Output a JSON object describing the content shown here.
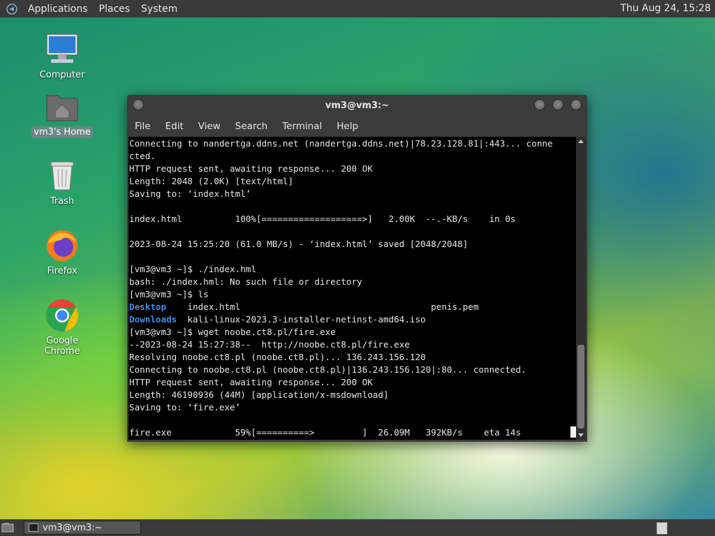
{
  "top_panel": {
    "menus": [
      "Applications",
      "Places",
      "System"
    ],
    "clock": "Thu Aug 24, 15:28"
  },
  "desktop_icons": [
    {
      "label": "Computer",
      "icon": "computer-icon"
    },
    {
      "label": "vm3's Home",
      "icon": "home-folder-icon",
      "selected": true
    },
    {
      "label": "Trash",
      "icon": "trash-icon"
    },
    {
      "label": "Firefox",
      "icon": "firefox-icon"
    },
    {
      "label": "Google Chrome",
      "icon": "chrome-icon"
    }
  ],
  "terminal": {
    "title": "vm3@vm3:~",
    "menu": [
      "File",
      "Edit",
      "View",
      "Search",
      "Terminal",
      "Help"
    ],
    "lines": [
      "Connecting to nandertga.ddns.net (nandertga.ddns.net)|78.23.128.81|:443... conne",
      "cted.",
      "HTTP request sent, awaiting response... 200 OK",
      "Length: 2048 (2.0K) [text/html]",
      "Saving to: ‘index.html’",
      "",
      "index.html          100%[===================>]   2.00K  --.-KB/s    in 0s",
      "",
      "2023-08-24 15:25:20 (61.0 MB/s) - ‘index.html’ saved [2048/2048]",
      "",
      "[vm3@vm3 ~]$ ./index.hml",
      "bash: ./index.hml: No such file or directory",
      "[vm3@vm3 ~]$ ls",
      "",
      "",
      "[vm3@vm3 ~]$ wget noobe.ct8.pl/fire.exe",
      "--2023-08-24 15:27:38--  http://noobe.ct8.pl/fire.exe",
      "Resolving noobe.ct8.pl (noobe.ct8.pl)... 136.243.156.120",
      "Connecting to noobe.ct8.pl (noobe.ct8.pl)|136.243.156.120|:80... connected.",
      "HTTP request sent, awaiting response... 200 OK",
      "Length: 46190936 (44M) [application/x-msdownload]",
      "Saving to: ‘fire.exe’",
      "",
      "fire.exe            59%[==========>         ]  26.09M   392KB/s    eta 14s"
    ],
    "ls_row1": {
      "dir": "Desktop",
      "rest": "    index.html                                    penis.pem"
    },
    "ls_row2": {
      "dir": "Downloads",
      "rest": "  kali-linux-2023.3-installer-netinst-amd64.iso"
    }
  },
  "bottom_panel": {
    "task_label": "vm3@vm3:~"
  },
  "colors": {
    "directory": "#3b8eea",
    "terminal_bg": "#000000",
    "panel_bg": "#3a3a3a"
  }
}
